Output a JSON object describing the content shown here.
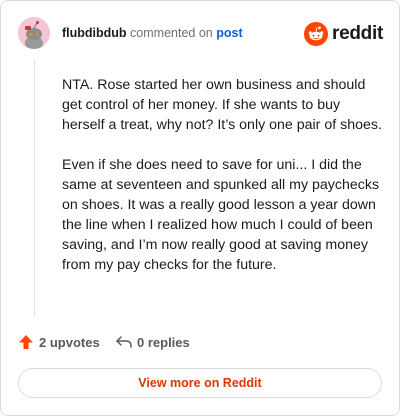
{
  "header": {
    "username": "flubdibdub",
    "action_text": "commented on",
    "post_link": "post",
    "brand": "reddit"
  },
  "comment": {
    "paragraphs": [
      "NTA. Rose started her own business and should get control of her money. If she wants to buy herself a treat, why not? It’s only one pair of shoes.",
      "Even if she does need to save for uni... I did the same at seventeen and spunked all my paychecks on shoes. It was a really good lesson a year down the line when I realized how much I could of been saving, and I’m now really good at saving money from my pay checks for the future."
    ]
  },
  "actions": {
    "upvotes": "2 upvotes",
    "replies": "0 replies"
  },
  "footer": {
    "view_more": "View more on Reddit"
  },
  "colors": {
    "brand": "#ff4500",
    "link": "#0a5fd6",
    "view_more": "#d93900"
  },
  "icons": [
    "snoo-avatar-icon",
    "reddit-logo-icon",
    "upvote-arrow-icon",
    "reply-arrow-icon"
  ]
}
